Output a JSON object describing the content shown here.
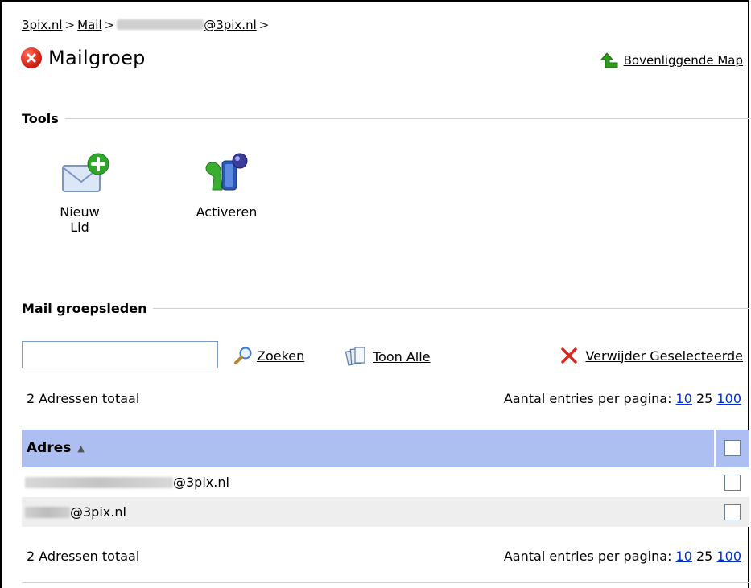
{
  "breadcrumb": {
    "items": [
      "3pix.nl",
      "Mail"
    ],
    "email_suffix": "@3pix.nl",
    "separator": ">"
  },
  "header": {
    "title": "Mailgroep",
    "parent_link": "Bovenliggende Map"
  },
  "tools": {
    "heading": "Tools",
    "new_member": "Nieuw Lid",
    "activate": "Activeren"
  },
  "members": {
    "heading": "Mail groepsleden",
    "search_value": "",
    "search_label": "Zoeken",
    "show_all_label": "Toon Alle",
    "delete_selected_label": "Verwijder Geselecteerde",
    "total_text": "2 Adressen totaal",
    "per_page_label": "Aantal entries per pagina:",
    "per_page_options": [
      "10",
      "25",
      "100"
    ],
    "column_address": "Adres",
    "rows": [
      {
        "suffix": "@3pix.nl"
      },
      {
        "suffix": "@3pix.nl"
      }
    ]
  },
  "colors": {
    "header_bg": "#adbef0",
    "link_blue": "#0033cc",
    "alt_row": "#eeeeee"
  },
  "icons": [
    "close-circle-icon",
    "arrow-up-icon",
    "mail-add-icon",
    "activate-icon",
    "search-icon",
    "show-all-icon",
    "delete-icon",
    "sort-asc-icon",
    "checkbox-icon"
  ]
}
